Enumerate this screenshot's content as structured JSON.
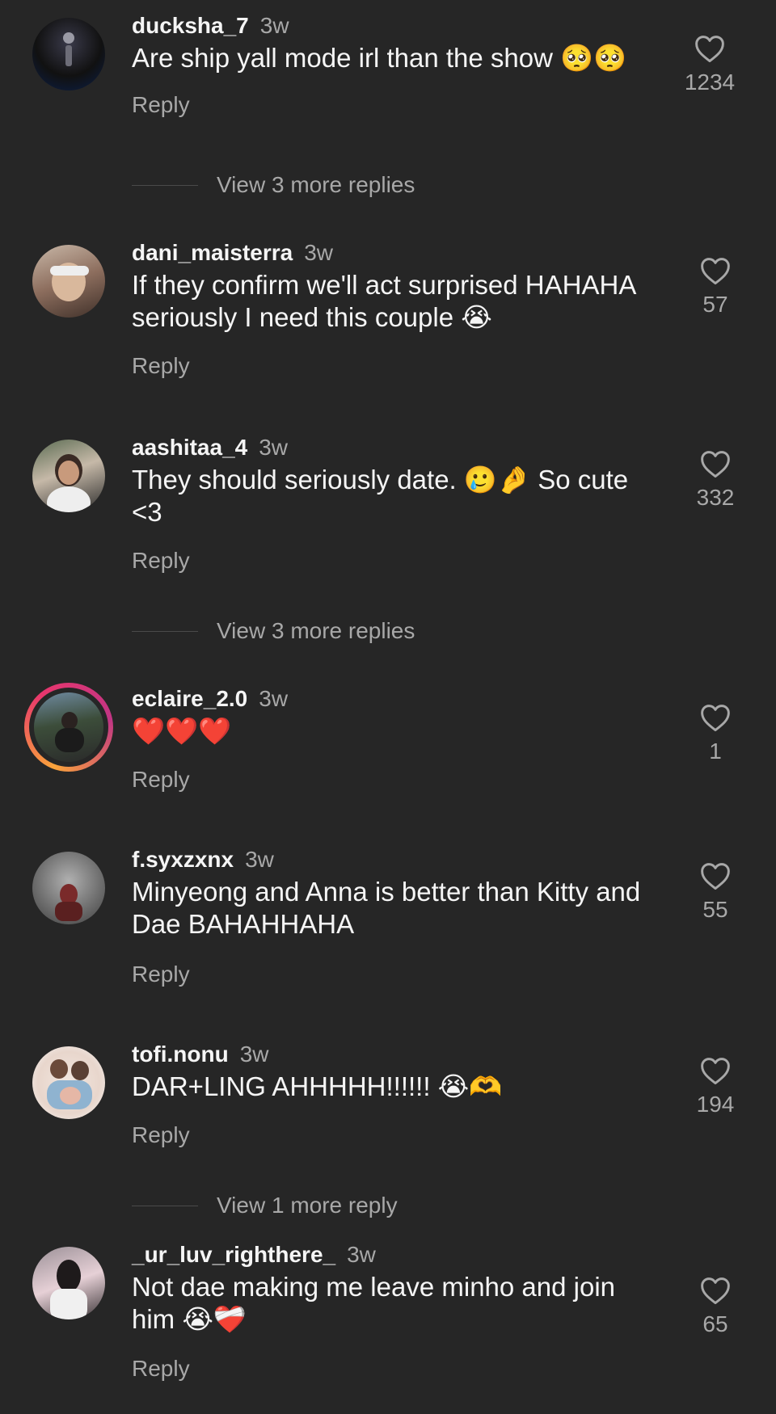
{
  "comments": [
    {
      "username": "ducksha_7",
      "time": "3w",
      "text": "Are ship yall mode irl than the show 🥺🥺",
      "reply": "Reply",
      "likes": "1234",
      "view_replies": "View 3 more replies"
    },
    {
      "username": "dani_maisterra",
      "time": "3w",
      "text": "If they confirm we'll act surprised HAHAHA seriously I need this couple 😭",
      "reply": "Reply",
      "likes": "57"
    },
    {
      "username": "aashitaa_4",
      "time": "3w",
      "text": "They should seriously date. 🥲🤌 So cute <3",
      "reply": "Reply",
      "likes": "332",
      "view_replies": "View 3 more replies"
    },
    {
      "username": "eclaire_2.0",
      "time": "3w",
      "text": "❤️❤️❤️",
      "reply": "Reply",
      "likes": "1"
    },
    {
      "username": "f.syxzxnx",
      "time": "3w",
      "text": "Minyeong and Anna is better than Kitty and Dae BAHAHHAHA",
      "reply": "Reply",
      "likes": "55"
    },
    {
      "username": "tofi.nonu",
      "time": "3w",
      "text": "DAR+LING AHHHHH!!!!!! 😭🫶",
      "reply": "Reply",
      "likes": "194",
      "view_replies": "View 1 more reply"
    },
    {
      "username": "_ur_luv_righthere_",
      "time": "3w",
      "text": "Not dae making me leave minho and join him 😭❤️‍🩹",
      "reply": "Reply",
      "likes": "65"
    }
  ],
  "icons": {
    "like": "heart-outline-icon"
  },
  "colors": {
    "background": "#262626",
    "primary_text": "#f5f5f5",
    "secondary_text": "#a8a8a8",
    "story_ring": "#e8366d"
  }
}
